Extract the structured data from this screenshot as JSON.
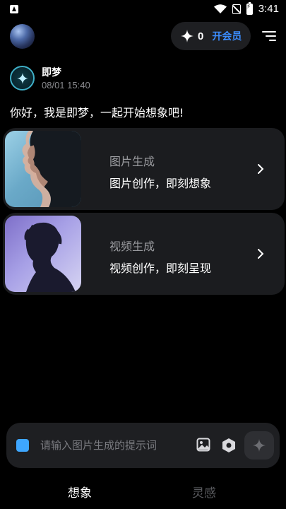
{
  "status_bar": {
    "time": "3:41"
  },
  "header": {
    "credits": "0",
    "vip_label": "开会员",
    "accent_color": "#3b8dff"
  },
  "bot": {
    "name": "即梦",
    "timestamp": "08/01 15:40",
    "greeting": "你好，我是即梦，一起开始想象吧!"
  },
  "cards": [
    {
      "subtitle": "图片生成",
      "title": "图片创作，即刻想象"
    },
    {
      "subtitle": "视频生成",
      "title": "视频创作，即刻呈现"
    }
  ],
  "input": {
    "placeholder": "请输入图片生成的提示词"
  },
  "tabs": [
    {
      "label": "想象",
      "active": true
    },
    {
      "label": "灵感",
      "active": false
    }
  ],
  "icons": [
    "app-icon",
    "wifi-icon",
    "no-sim-icon",
    "battery-charging-icon",
    "sparkle-icon",
    "filter-icon",
    "chevron-right-icon",
    "image-icon",
    "settings-hex-icon",
    "send-sparkle-icon"
  ]
}
